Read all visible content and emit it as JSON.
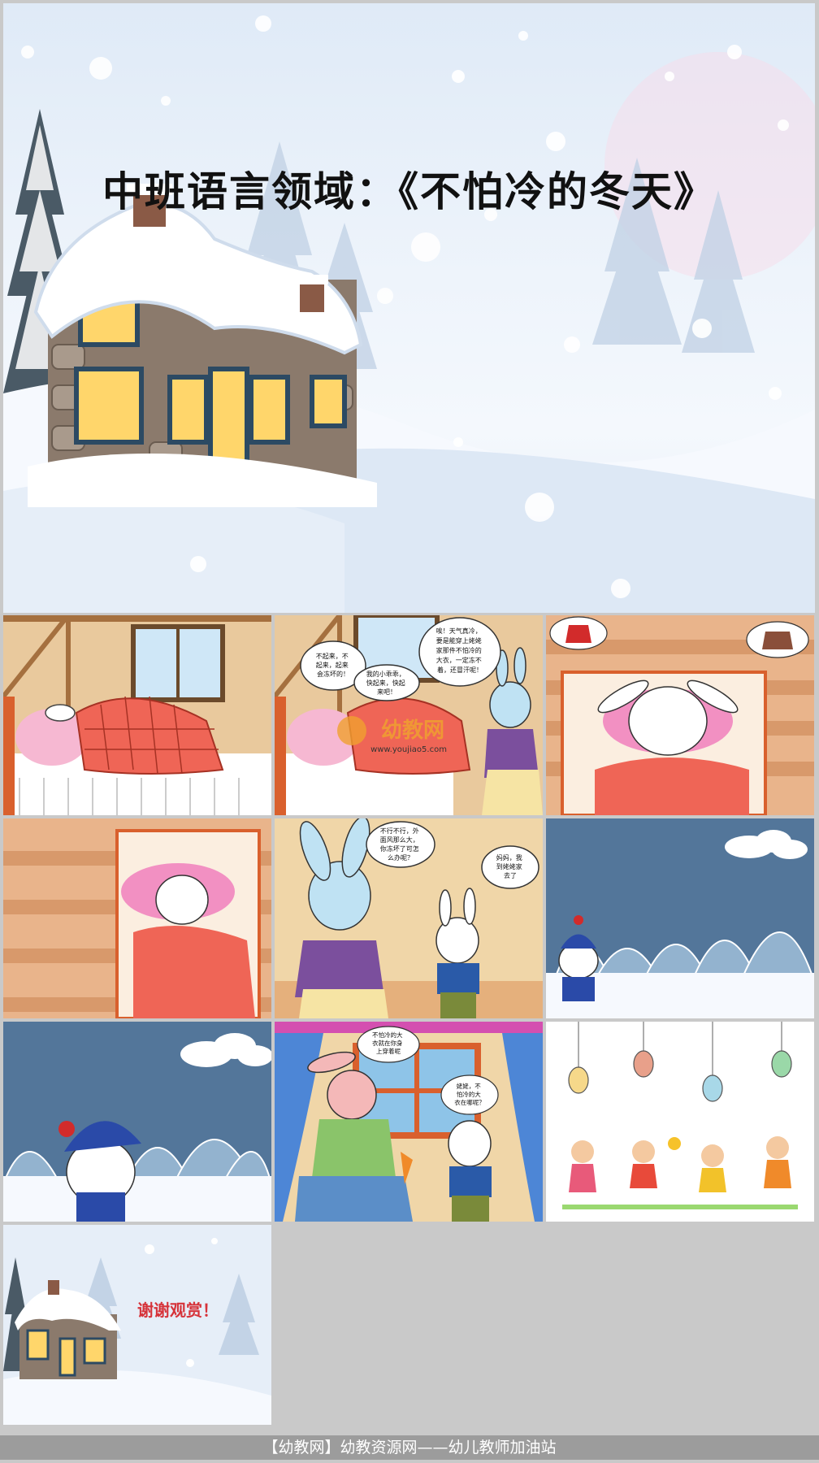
{
  "main_slide": {
    "title": "中班语言领域：《不怕冷的冬天》"
  },
  "slide2": {
    "bubble_left": [
      "不起来，不",
      "起来，起来",
      "会冻坏的！"
    ],
    "bubble_mid": [
      "我的小乖乖，",
      "快起来，快起",
      "来吧！"
    ],
    "bubble_right": [
      "唉！天气真冷，",
      "要是能穿上姥姥",
      "家那件不怕冷的",
      "大衣，一定冻不",
      "着，还冒汗呢！"
    ],
    "watermark_brand": "幼教网",
    "watermark_url": "www.youjiao5.com"
  },
  "slide5": {
    "bubble_left": [
      "不行不行，外",
      "面风那么大，",
      "你冻坏了可怎",
      "么办呢？"
    ],
    "bubble_right": [
      "妈妈，我",
      "到姥姥家",
      "去了"
    ]
  },
  "slide8": {
    "bubble_top": [
      "不怕冷的大",
      "衣就在你身",
      "上穿着呢"
    ],
    "bubble_right": [
      "姥姥，不",
      "怕冷的大",
      "衣在哪呢？"
    ]
  },
  "slide10": {
    "thanks": "谢谢观赏！"
  },
  "footer": {
    "text": "【幼教网】幼教资源网——幼儿教师加油站"
  },
  "colors": {
    "title": "#111111",
    "thanks": "#d6333a",
    "footer_bg": "#9c9c9c",
    "watermark": "#f0a030"
  }
}
